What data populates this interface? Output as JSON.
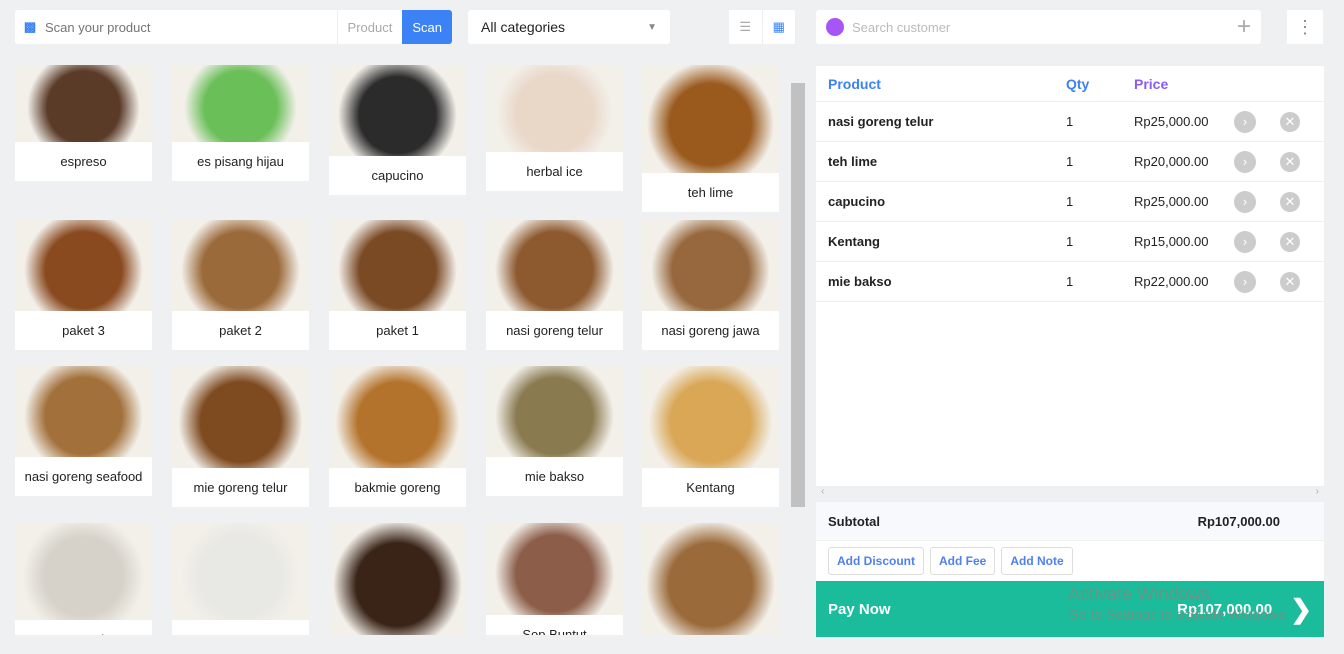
{
  "toolbar": {
    "scan_placeholder": "Scan your product",
    "product_label": "Product",
    "scan_label": "Scan",
    "category": "All categories",
    "customer_placeholder": "Search customer"
  },
  "products": [
    {
      "name": "espreso",
      "color": "#5a3b28"
    },
    {
      "name": "es pisang hijau",
      "color": "#6bbf59"
    },
    {
      "name": "capucino",
      "color": "#2b2b2b"
    },
    {
      "name": "herbal ice",
      "color": "#e9d7c8"
    },
    {
      "name": "teh lime",
      "color": "#9a5a1e"
    },
    {
      "name": "paket 3",
      "color": "#8a4a20"
    },
    {
      "name": "paket 2",
      "color": "#9b6a3a"
    },
    {
      "name": "paket 1",
      "color": "#7a4a25"
    },
    {
      "name": "nasi goreng telur",
      "color": "#8d5a30"
    },
    {
      "name": "nasi goreng jawa",
      "color": "#97683d"
    },
    {
      "name": "nasi goreng seafood",
      "color": "#a2703a"
    },
    {
      "name": "mie goreng telur",
      "color": "#7e4a1f"
    },
    {
      "name": "bakmie goreng",
      "color": "#b4732c"
    },
    {
      "name": "mie bakso",
      "color": "#8a7a50"
    },
    {
      "name": "Kentang",
      "color": "#d9a756"
    },
    {
      "name": "Kerupuk",
      "color": "#d6d2c9"
    },
    {
      "name": "",
      "color": "#e8e8e4"
    },
    {
      "name": "",
      "color": "#3a2418"
    },
    {
      "name": "Sop Buntut",
      "color": "#8c5e4a"
    },
    {
      "name": "",
      "color": "#9a6a3a"
    }
  ],
  "cart": {
    "headers": {
      "product": "Product",
      "qty": "Qty",
      "price": "Price"
    },
    "items": [
      {
        "name": "nasi goreng telur",
        "qty": "1",
        "price": "Rp25,000.00"
      },
      {
        "name": "teh lime",
        "qty": "1",
        "price": "Rp20,000.00"
      },
      {
        "name": "capucino",
        "qty": "1",
        "price": "Rp25,000.00"
      },
      {
        "name": "Kentang",
        "qty": "1",
        "price": "Rp15,000.00"
      },
      {
        "name": "mie bakso",
        "qty": "1",
        "price": "Rp22,000.00"
      }
    ],
    "subtotal_label": "Subtotal",
    "subtotal": "Rp107,000.00",
    "add_discount": "Add Discount",
    "add_fee": "Add Fee",
    "add_note": "Add Note",
    "pay_label": "Pay Now",
    "pay_amount": "Rp107,000.00"
  },
  "watermark": {
    "title": "Activate Windows",
    "sub": "Go to Settings to activate Windows."
  }
}
